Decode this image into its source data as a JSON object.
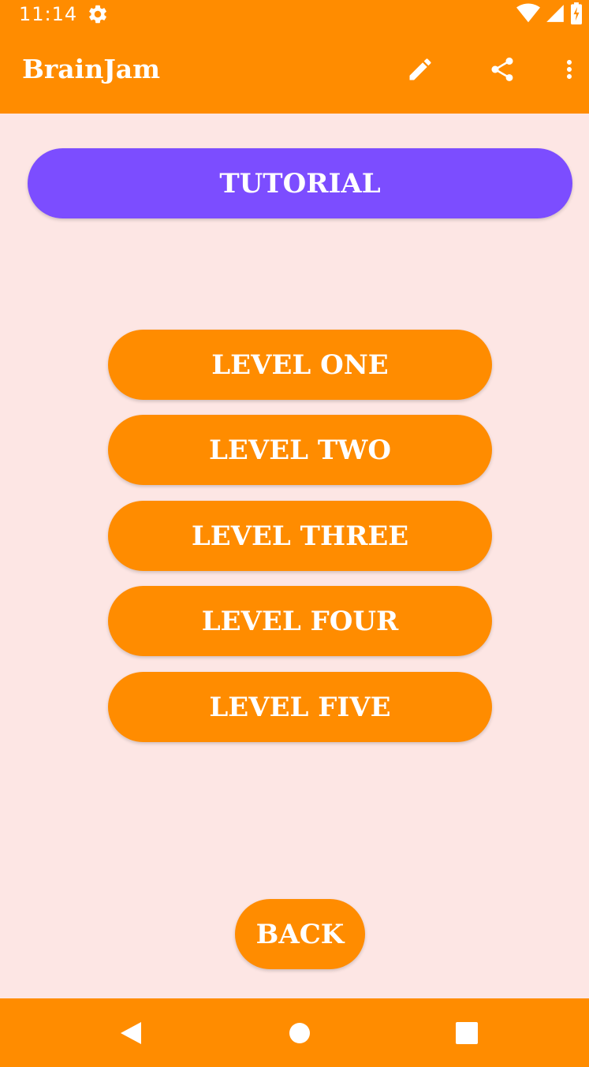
{
  "status_bar": {
    "time": "11:14",
    "icons": [
      "gear-icon",
      "wifi-icon",
      "signal-icon",
      "battery-charging-icon"
    ]
  },
  "app_bar": {
    "title": "BrainJam",
    "actions": [
      "edit-icon",
      "share-icon",
      "more-vert-icon"
    ]
  },
  "main": {
    "tutorial_label": "TUTORIAL",
    "levels": [
      {
        "label": "LEVEL ONE"
      },
      {
        "label": "LEVEL TWO"
      },
      {
        "label": "LEVEL THREE"
      },
      {
        "label": "LEVEL FOUR"
      },
      {
        "label": "LEVEL FIVE"
      }
    ],
    "back_label": "BACK"
  },
  "nav_bar": {
    "icons": [
      "back-triangle-icon",
      "home-circle-icon",
      "recents-square-icon"
    ]
  },
  "colors": {
    "primary": "#FF8C00",
    "accent": "#7C4DFF",
    "background": "#FDE6E4",
    "text_on_primary": "#FFFFFF"
  }
}
